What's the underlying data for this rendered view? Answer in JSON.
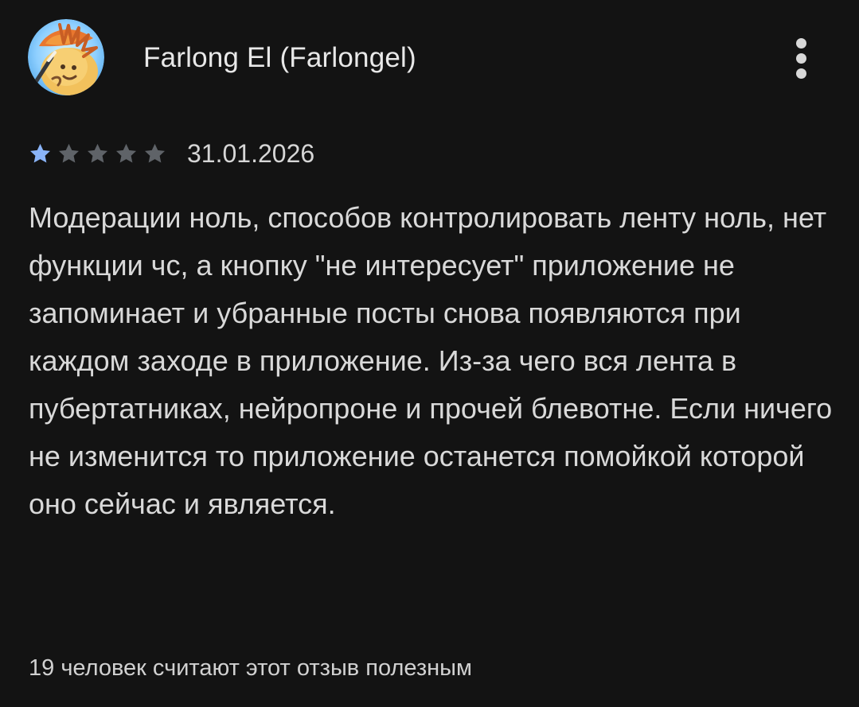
{
  "review": {
    "author_name": "Farlong El (Farlongel)",
    "avatar_icon": "cartoon-avatar-icon",
    "menu_icon": "more-vert-icon",
    "rating": {
      "value": 1,
      "max": 5,
      "filled_color": "#8ab4f8",
      "empty_color": "#5f6368"
    },
    "date": "31.01.2026",
    "text": "Модерации ноль, способов контролировать ленту ноль, нет функции чс, а кнопку \"не интересует\" приложение не запоминает и убранные посты снова появляются при каждом заходе в приложение. Из-за чего вся лента в пубертатниках, нейропроне и прочей блевотне. Если ничего не изменится то приложение останется помойкой которой оно сейчас и является.",
    "helpful_text": "19 человек считают этот отзыв полезным"
  },
  "theme": {
    "background": "#131313",
    "text_primary": "#e3e3e3",
    "text_secondary": "#d6d6d6"
  }
}
